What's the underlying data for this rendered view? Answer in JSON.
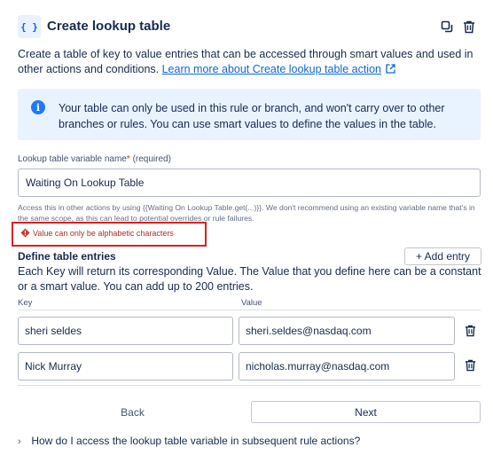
{
  "header": {
    "icon_text": "{ }",
    "title": "Create lookup table"
  },
  "description": {
    "text": "Create a table of key to value entries that can be accessed through smart values and used in other actions and conditions. ",
    "link": "Learn more about Create lookup table action"
  },
  "info": {
    "icon_text": "i",
    "text": "Your table can only be used in this rule or branch, and won't carry over to other branches or rules. You can use smart values to define the values in the table."
  },
  "variable_field": {
    "label": "Lookup table variable name",
    "required_mark": "*",
    "required_text": "(required)",
    "value": "Waiting On Lookup Table",
    "help": "Access this in other actions by using {{Waiting On Lookup Table.get(...)}}. We don't recommend using an existing variable name that's in the same scope, as this can lead to potential overrides or rule failures.",
    "error": "Value can only be alphabetic characters"
  },
  "entries": {
    "title": "Define table entries",
    "add_label": "+ Add entry",
    "description": "Each Key will return its corresponding Value. The Value that you define here can be a constant or a smart value. You can add up to 200 entries.",
    "key_header": "Key",
    "value_header": "Value",
    "rows": [
      {
        "key": "sheri seldes",
        "value": "sheri.seldes@nasdaq.com"
      },
      {
        "key": "Nick Murray",
        "value": "nicholas.murray@nasdaq.com"
      }
    ]
  },
  "actions": {
    "back": "Back",
    "next": "Next"
  },
  "faq": {
    "chevron": "›",
    "text": "How do I access the lookup table variable in subsequent rule actions?"
  },
  "colors": {
    "accent": "#0c66e4",
    "info_bg": "#e9f2ff",
    "error": "#e01e1e",
    "text": "#172b4d"
  }
}
